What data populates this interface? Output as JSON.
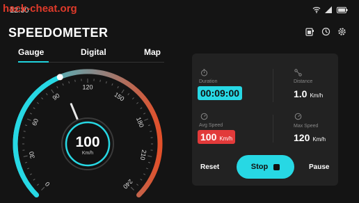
{
  "watermark": "hack-cheat.org",
  "status": {
    "time": "12:30"
  },
  "app": {
    "title": "SPEEDOMETER"
  },
  "tabs": [
    {
      "label": "Gauge"
    },
    {
      "label": "Digital"
    },
    {
      "label": "Map"
    }
  ],
  "gauge": {
    "speed": "100",
    "unit": "Km/h",
    "ticks": [
      "0",
      "30",
      "60",
      "90",
      "120",
      "150",
      "180",
      "210",
      "240"
    ],
    "min": 0,
    "max": 240,
    "value": 100,
    "colors": {
      "accent": "#27d8e4",
      "hot": "#e2502a"
    }
  },
  "stats": {
    "duration": {
      "label": "Duration",
      "value": "00:09:00"
    },
    "distance": {
      "label": "Distance",
      "value": "1.0",
      "unit": "Km/h"
    },
    "avg_speed": {
      "label": "Avg Speed",
      "value": "100",
      "unit": "Km/h"
    },
    "max_speed": {
      "label": "Max Speed",
      "value": "120",
      "unit": "Km/h"
    }
  },
  "controls": {
    "reset": "Reset",
    "stop": "Stop",
    "pause": "Pause"
  },
  "icons": {
    "top": [
      "battery-icon",
      "history-icon",
      "settings-icon"
    ]
  }
}
